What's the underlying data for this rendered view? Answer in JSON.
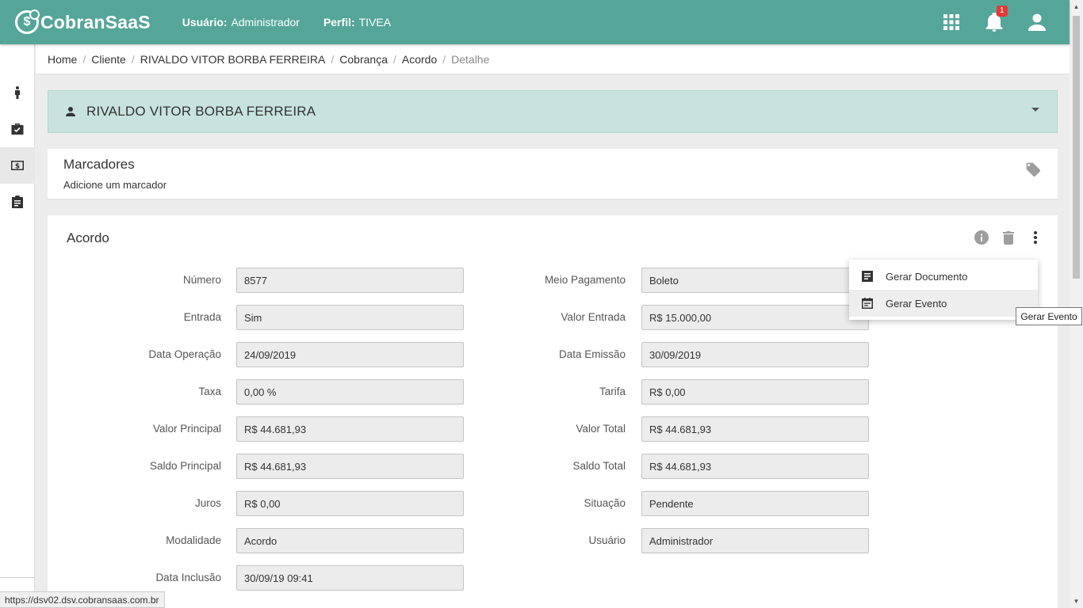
{
  "header": {
    "brand": "CobranSaaS",
    "logo_glyph": "$",
    "user_label": "Usuário:",
    "user_value": "Administrador",
    "profile_label": "Perfil:",
    "profile_value": "TIVEA",
    "notifications_count": "1",
    "icons": [
      "apps-grid-icon",
      "bell-icon",
      "account-icon"
    ]
  },
  "sidebar": {
    "items": [
      {
        "icon": "person-icon"
      },
      {
        "icon": "briefcase-icon"
      },
      {
        "icon": "money-icon",
        "active": true
      },
      {
        "icon": "clipboard-icon"
      }
    ]
  },
  "breadcrumb": [
    "Home",
    "Cliente",
    "RIVALDO VITOR BORBA FERREIRA",
    "Cobrança",
    "Acordo",
    "Detalhe"
  ],
  "client": {
    "name": "RIVALDO VITOR BORBA FERREIRA"
  },
  "markers": {
    "title": "Marcadores",
    "add_label": "Adicione um marcador"
  },
  "acordo": {
    "title": "Acordo",
    "left_fields": [
      {
        "label": "Número",
        "value": "8577"
      },
      {
        "label": "Entrada",
        "value": "Sim"
      },
      {
        "label": "Data Operação",
        "value": "24/09/2019"
      },
      {
        "label": "Taxa",
        "value": "0,00 %"
      },
      {
        "label": "Valor Principal",
        "value": "R$ 44.681,93"
      },
      {
        "label": "Saldo Principal",
        "value": "R$ 44.681,93"
      },
      {
        "label": "Juros",
        "value": "R$ 0,00"
      },
      {
        "label": "Modalidade",
        "value": "Acordo"
      },
      {
        "label": "Data Inclusão",
        "value": "30/09/19 09:41"
      }
    ],
    "right_fields": [
      {
        "label": "Meio Pagamento",
        "value": "Boleto"
      },
      {
        "label": "Valor Entrada",
        "value": "R$ 15.000,00"
      },
      {
        "label": "Data Emissão",
        "value": "30/09/2019"
      },
      {
        "label": "Tarifa",
        "value": "R$ 0,00"
      },
      {
        "label": "Valor Total",
        "value": "R$ 44.681,93"
      },
      {
        "label": "Saldo Total",
        "value": "R$ 44.681,93"
      },
      {
        "label": "Situação",
        "value": "Pendente"
      },
      {
        "label": "Usuário",
        "value": "Administrador"
      }
    ]
  },
  "menu": {
    "items": [
      {
        "label": "Gerar Documento",
        "icon": "document-icon"
      },
      {
        "label": "Gerar Evento",
        "icon": "event-icon"
      }
    ],
    "tooltip": "Gerar Evento"
  },
  "statusbar": {
    "url": "https://dsv02.dsv.cobransaas.com.br"
  },
  "colors": {
    "primary": "#55a699",
    "client_panel": "#c8e3dd",
    "badge": "#e53935"
  }
}
